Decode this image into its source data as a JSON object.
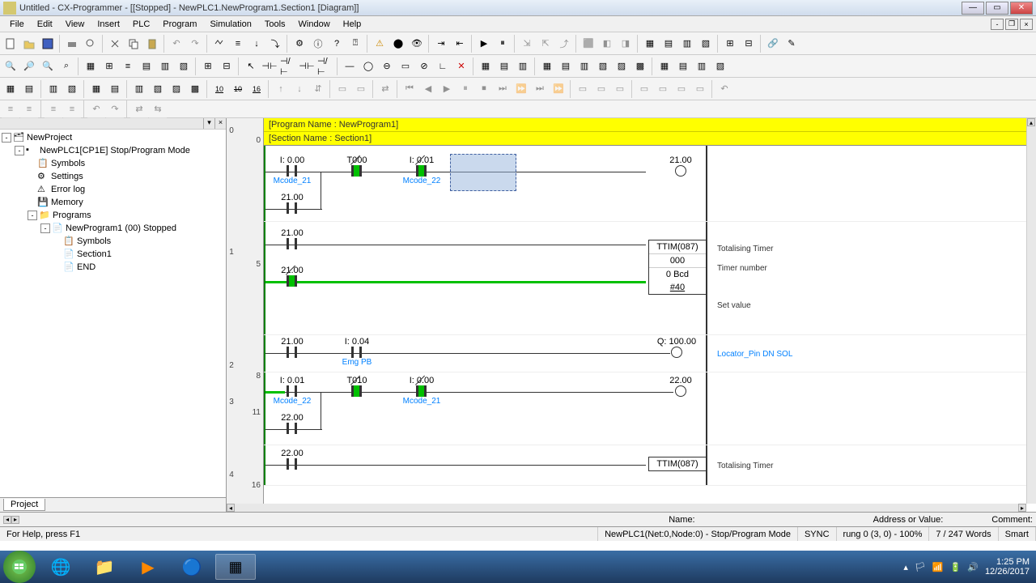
{
  "title": "Untitled - CX-Programmer - [[Stopped] - NewPLC1.NewProgram1.Section1 [Diagram]]",
  "menus": [
    "File",
    "Edit",
    "View",
    "Insert",
    "PLC",
    "Program",
    "Simulation",
    "Tools",
    "Window",
    "Help"
  ],
  "tree": {
    "root": "NewProject",
    "plc": "NewPLC1[CP1E] Stop/Program Mode",
    "items": [
      "Symbols",
      "Settings",
      "Error log",
      "Memory",
      "Programs"
    ],
    "program": "NewProgram1 (00) Stopped",
    "prog_items": [
      "Symbols",
      "Section1",
      "END"
    ]
  },
  "project_tab": "Project",
  "diagram": {
    "program_name": "[Program Name : NewProgram1]",
    "section_name": "[Section Name : Section1]",
    "rung0": {
      "c1": "I: 0.00",
      "c1_cmt": "Mcode_21",
      "c2": "T000",
      "c3": "I: 0.01",
      "c3_cmt": "Mcode_22",
      "out": "21.00",
      "branch": "21.00"
    },
    "rung1": {
      "c1": "21.00",
      "c2": "21.00",
      "fb_title": "TTIM(087)",
      "fb_annot1": "Totalising Timer",
      "fb_v1": "000",
      "fb_annot2": "Timer number",
      "fb_v2": "0 Bcd",
      "fb_v3": "#40",
      "fb_annot3": "Set value"
    },
    "rung2": {
      "c1": "21.00",
      "c2": "I: 0.04",
      "c2_cmt": "Emg PB",
      "out": "Q: 100.00",
      "out_cmt": "Locator_Pin DN SOL"
    },
    "rung3": {
      "c1": "I: 0.01",
      "c1_cmt": "Mcode_22",
      "c2": "T010",
      "c3": "I: 0.00",
      "c3_cmt": "Mcode_21",
      "out": "22.00",
      "branch": "22.00"
    },
    "rung4": {
      "c1": "22.00",
      "fb_title": "TTIM(087)",
      "fb_annot1": "Totalising Timer"
    },
    "rung_nums": [
      "0",
      "1",
      "2",
      "3",
      "4"
    ],
    "step_nums": [
      "0",
      "5",
      "8",
      "11",
      "16"
    ]
  },
  "info": {
    "name_label": "Name:",
    "addr_label": "Address or Value:",
    "comment_label": "Comment:"
  },
  "status": {
    "help": "For Help, press F1",
    "conn": "NewPLC1(Net:0,Node:0) - Stop/Program Mode",
    "sync": "SYNC",
    "rung": "rung 0 (3, 0) - 100%",
    "words": "7 / 247 Words",
    "smart": "Smart"
  },
  "systray": {
    "time": "1:25 PM",
    "date": "12/26/2017"
  }
}
